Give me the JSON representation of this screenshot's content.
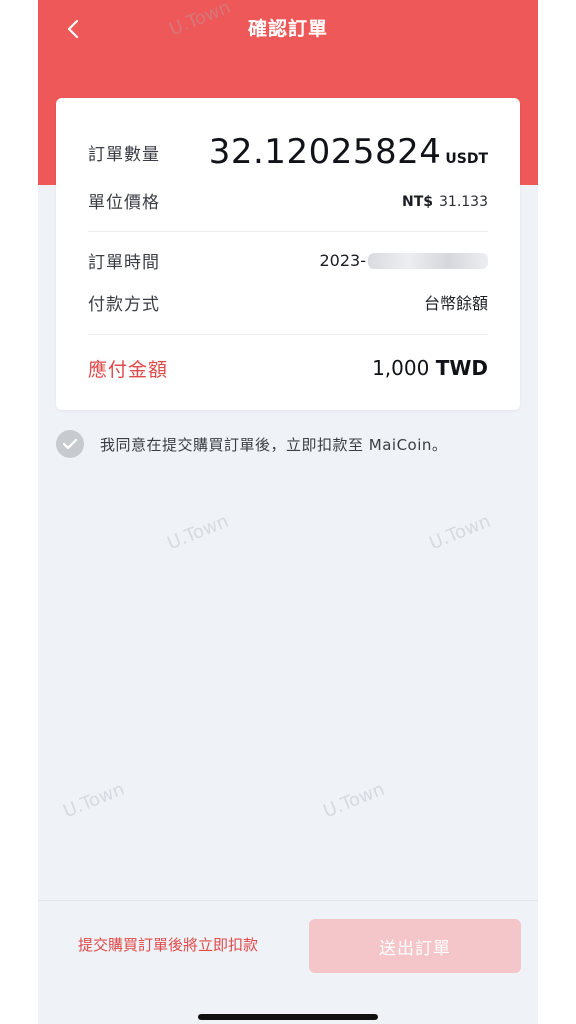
{
  "header": {
    "title": "確認訂單",
    "back_icon": "chevron-left-icon",
    "background_color": "#ee5858"
  },
  "order": {
    "quantity_label": "訂單數量",
    "quantity_value": "32.12025824",
    "quantity_unit": "USDT",
    "unit_price_label": "單位價格",
    "unit_price_currency": "NT$",
    "unit_price_value": "31.133",
    "order_time_label": "訂單時間",
    "order_time_value": "2023-",
    "payment_method_label": "付款方式",
    "payment_method_value": "台幣餘額",
    "amount_due_label": "應付金額",
    "amount_due_value": "1,000",
    "amount_due_currency": "TWD"
  },
  "agreement": {
    "text": "我同意在提交購買訂單後，立即扣款至 MaiCoin。",
    "checked": true
  },
  "footer": {
    "notice": "提交購買訂單後將立即扣款",
    "submit_label": "送出訂單"
  },
  "watermark": "U.Town"
}
